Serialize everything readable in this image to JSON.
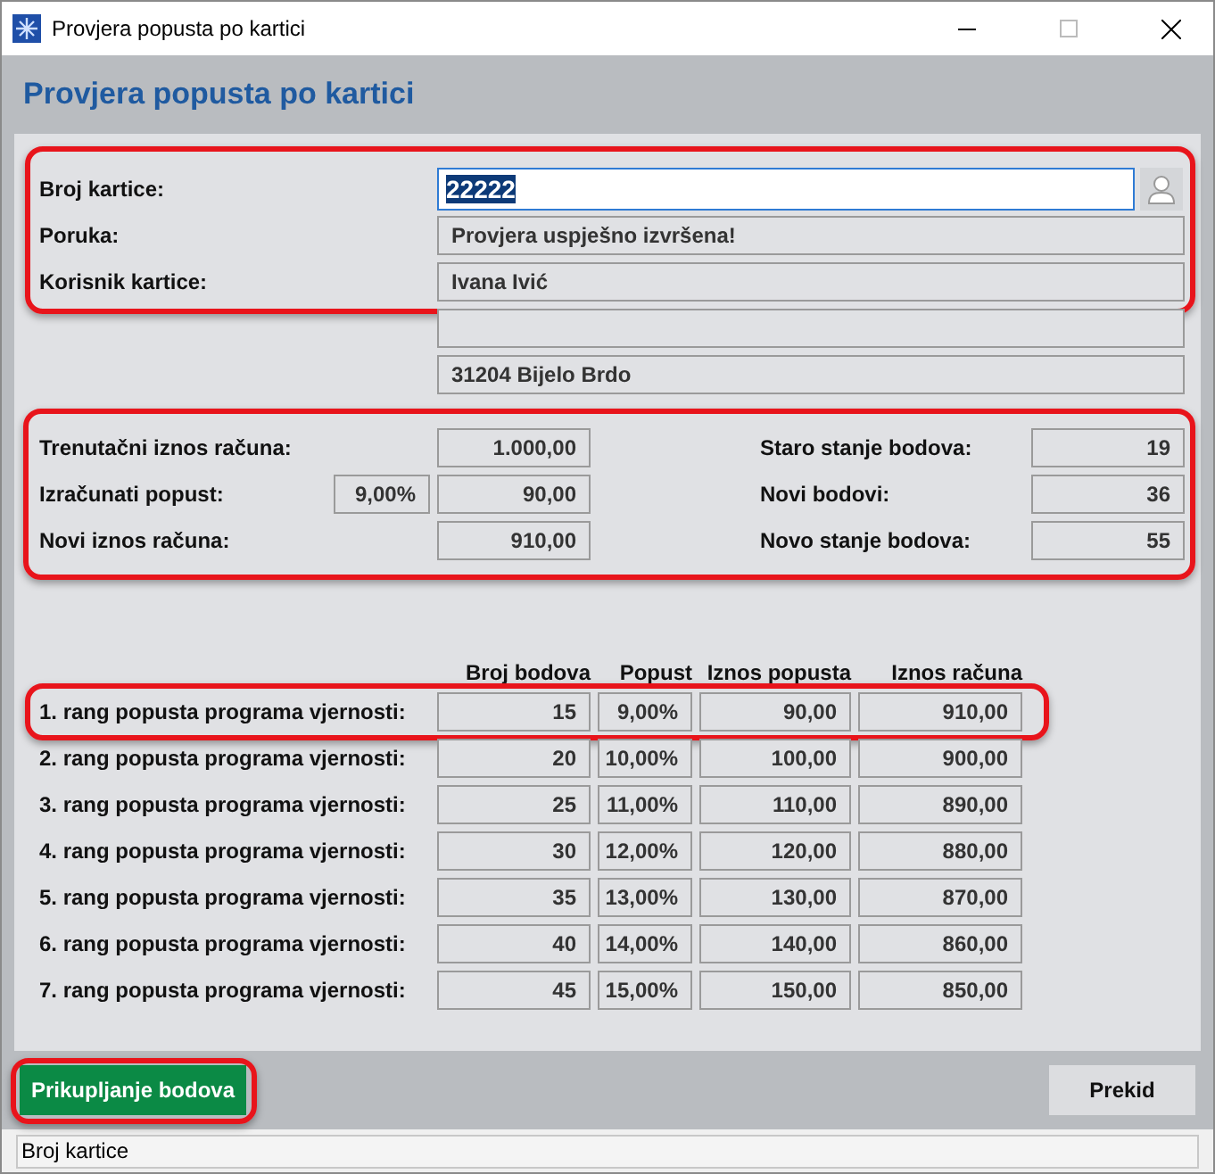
{
  "window": {
    "title": "Provjera popusta po kartici"
  },
  "header": {
    "title": "Provjera popusta po kartici"
  },
  "card_section": {
    "highlighted": true,
    "fields": [
      {
        "label": "Broj kartice:",
        "value": "22222",
        "kind": "input",
        "text_selected": true
      },
      {
        "label": "Poruka:",
        "value": "Provjera uspješno izvršena!",
        "kind": "readonly"
      },
      {
        "label": "Korisnik kartice:",
        "value": "Ivana Ivić",
        "kind": "readonly"
      }
    ]
  },
  "address_fields": [
    {
      "kind": "empty"
    },
    {
      "kind": "text",
      "value": "31204 Bijelo Brdo"
    }
  ],
  "totals": {
    "highlighted": true,
    "left": [
      {
        "label": "Trenutačni iznos računa:",
        "value": "1.000,00"
      },
      {
        "label": "Izračunati popust:",
        "percent": "9,00%",
        "value": "90,00"
      },
      {
        "label": "Novi iznos računa:",
        "value": "910,00"
      }
    ],
    "right": [
      {
        "label": "Staro stanje bodova:",
        "value": "19"
      },
      {
        "label": "Novi bodovi:",
        "value": "36"
      },
      {
        "label": "Novo stanje bodova:",
        "value": "55"
      }
    ]
  },
  "ranks": {
    "columns": [
      "Broj bodova",
      "Popust",
      "Iznos popusta",
      "Iznos računa"
    ],
    "rows": [
      {
        "label": "1. rang popusta programa vjernosti:",
        "values": [
          "15",
          "9,00%",
          "90,00",
          "910,00"
        ],
        "highlighted": true
      },
      {
        "label": "2. rang popusta programa vjernosti:",
        "values": [
          "20",
          "10,00%",
          "100,00",
          "900,00"
        ],
        "highlighted": false
      },
      {
        "label": "3. rang popusta programa vjernosti:",
        "values": [
          "25",
          "11,00%",
          "110,00",
          "890,00"
        ],
        "highlighted": false
      },
      {
        "label": "4. rang popusta programa vjernosti:",
        "values": [
          "30",
          "12,00%",
          "120,00",
          "880,00"
        ],
        "highlighted": false
      },
      {
        "label": "5. rang popusta programa vjernosti:",
        "values": [
          "35",
          "13,00%",
          "130,00",
          "870,00"
        ],
        "highlighted": false
      },
      {
        "label": "6. rang popusta programa vjernosti:",
        "values": [
          "40",
          "14,00%",
          "140,00",
          "860,00"
        ],
        "highlighted": false
      },
      {
        "label": "7. rang popusta programa vjernosti:",
        "values": [
          "45",
          "15,00%",
          "150,00",
          "850,00"
        ],
        "highlighted": false
      }
    ]
  },
  "buttons": [
    {
      "label": "Prikupljanje bodova",
      "kind": "primary",
      "highlighted": true
    },
    {
      "label": "Prekid",
      "kind": "secondary",
      "highlighted": false
    }
  ],
  "status_bar": {
    "text": "Broj kartice"
  }
}
